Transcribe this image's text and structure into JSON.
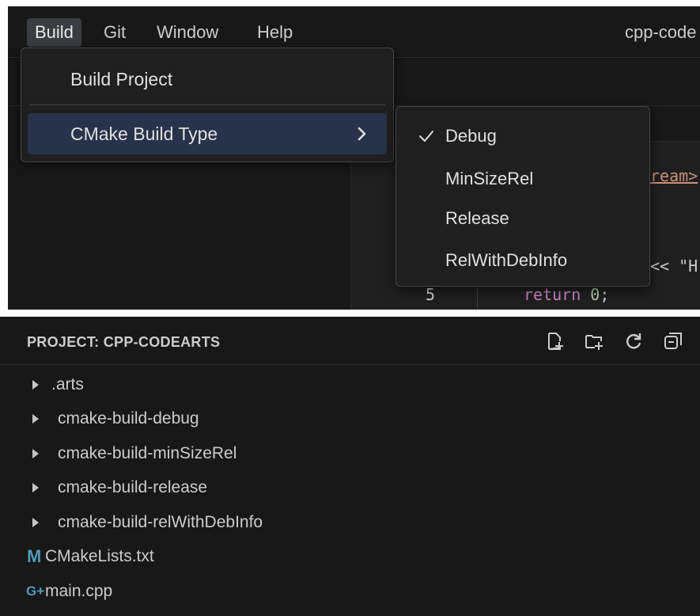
{
  "menubar": {
    "items": [
      "Build",
      "Git",
      "Window",
      "Help"
    ],
    "title": "cpp-code"
  },
  "build_menu": {
    "items": [
      "Build Project",
      "CMake Build Type"
    ]
  },
  "build_type_submenu": {
    "items": [
      "Debug",
      "MinSizeRel",
      "Release",
      "RelWithDebInfo"
    ],
    "selected": "Debug"
  },
  "editor": {
    "visible_code_fragments": [
      "ream>",
      "<< \"H"
    ],
    "line_number": "5",
    "return_keyword": "return",
    "return_value": "0",
    "return_semicolon": ";"
  },
  "explorer": {
    "title": "PROJECT: CPP-CODEARTS",
    "header_icons": [
      "new-file-icon",
      "new-folder-icon",
      "refresh-icon",
      "collapse-all-icon"
    ],
    "folders": [
      ".arts",
      "cmake-build-debug",
      "cmake-build-minSizeRel",
      "cmake-build-release",
      "cmake-build-relWithDebInfo"
    ],
    "files": [
      {
        "name": "CMakeLists.txt",
        "icon": "M",
        "icon_color": "#519aba"
      },
      {
        "name": "main.cpp",
        "icon": "G+",
        "icon_color": "#519aba"
      }
    ]
  },
  "colors": {
    "menu_bg": "#1f1f1f",
    "hover_bg": "#27334a",
    "keyword": "#c586c0",
    "number": "#b5cea8",
    "string": "#ce9178"
  }
}
